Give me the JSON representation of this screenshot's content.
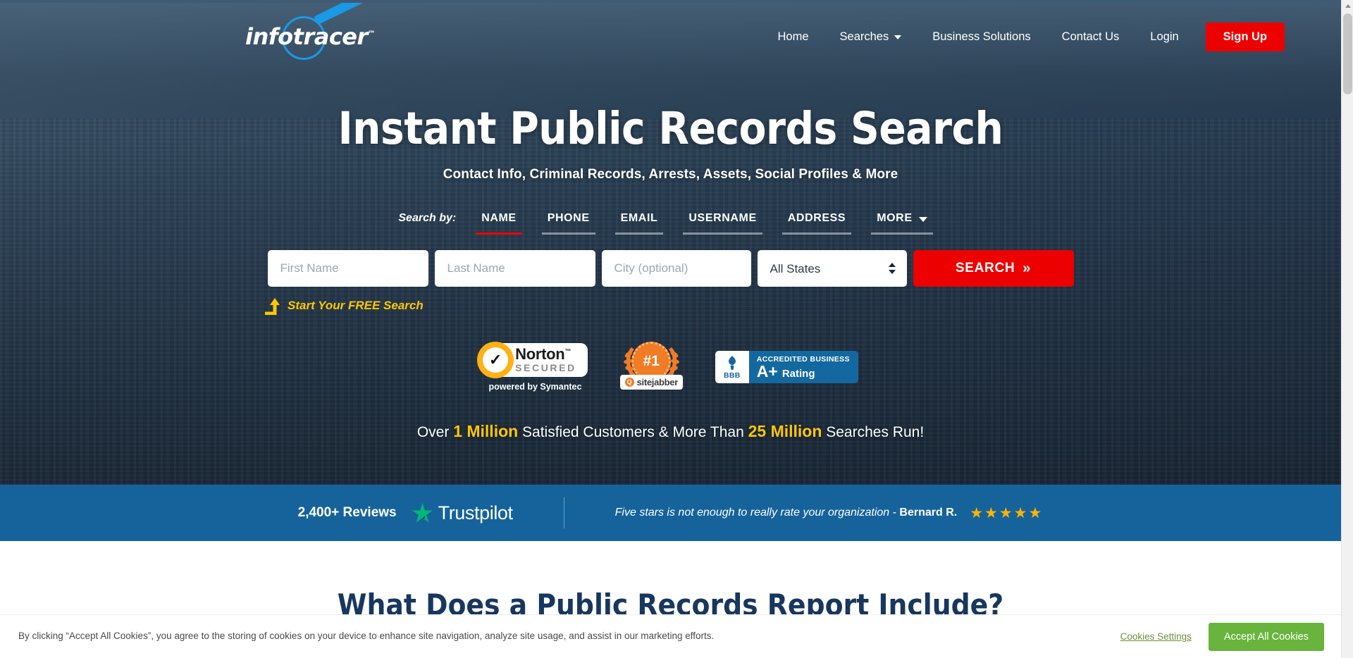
{
  "header": {
    "logo": {
      "info": "info",
      "tracer": "tracer",
      "tm": "™",
      "name": "infotracer"
    },
    "nav": [
      {
        "label": "Home",
        "has_caret": false
      },
      {
        "label": "Searches",
        "has_caret": true
      },
      {
        "label": "Business Solutions",
        "has_caret": false
      },
      {
        "label": "Contact Us",
        "has_caret": false
      },
      {
        "label": "Login",
        "has_caret": false
      }
    ],
    "signup_label": "Sign Up",
    "signup_color": "#ed0000"
  },
  "hero": {
    "title": "Instant Public Records Search",
    "subtitle": "Contact Info, Criminal Records, Arrests, Assets, Social Profiles & More",
    "search_by_label": "Search by:",
    "tabs": [
      {
        "label": "NAME",
        "active": true,
        "has_caret": false
      },
      {
        "label": "PHONE",
        "active": false,
        "has_caret": false
      },
      {
        "label": "EMAIL",
        "active": false,
        "has_caret": false
      },
      {
        "label": "USERNAME",
        "active": false,
        "has_caret": false
      },
      {
        "label": "ADDRESS",
        "active": false,
        "has_caret": false
      },
      {
        "label": "MORE",
        "active": false,
        "has_caret": true
      }
    ],
    "form": {
      "first_name_placeholder": "First Name",
      "first_name_value": "",
      "last_name_placeholder": "Last Name",
      "last_name_value": "",
      "city_placeholder": "City (optional)",
      "city_value": "",
      "state_selected": "All States",
      "state_options": [
        "All States"
      ],
      "search_label": "SEARCH",
      "search_chevrons": "»"
    },
    "free_note": "Start Your FREE Search",
    "free_note_color": "#ffc800",
    "stats": {
      "prefix": "Over ",
      "highlight1": "1 Million",
      "middle": " Satisfied Customers & More Than ",
      "highlight2": "25 Million",
      "suffix": " Searches Run!"
    }
  },
  "badges": {
    "norton": {
      "name": "Norton",
      "tm": "™",
      "secured": "SECURED",
      "powered_by": "powered by Symantec",
      "check": "✓"
    },
    "sitejabber": {
      "rank": "#1",
      "name": "sitejabber",
      "mark": "Q"
    },
    "bbb": {
      "short": "BBB",
      "accredited": "ACCREDITED BUSINESS",
      "grade": "A+",
      "rating_word": "Rating"
    }
  },
  "trustpilot": {
    "reviews_count": "2,400+ Reviews",
    "brand": "Trustpilot",
    "quote": "Five stars is not enough to really rate your organization - ",
    "author": "Bernard R.",
    "stars": "★★★★★",
    "star_color": "#ffb400",
    "bar_color": "#16639c"
  },
  "below_section": {
    "title": "What Does a Public Records Report Include?"
  },
  "cookie_banner": {
    "text": "By clicking “Accept All Cookies”, you agree to the storing of cookies on your device to enhance site navigation, analyze site usage, and assist in our marketing efforts.",
    "settings_label": "Cookies Settings",
    "accept_label": "Accept All Cookies",
    "accept_color": "#68b43c"
  }
}
